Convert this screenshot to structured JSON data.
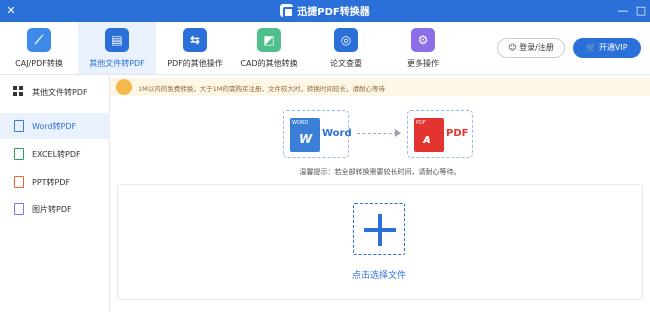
{
  "window": {
    "title": "迅捷PDF转换器",
    "close_glyph": "✕",
    "min_glyph": "—",
    "max_glyph": "□"
  },
  "toolbar": {
    "tools": [
      {
        "label": "CAJ/PDF转换",
        "icon": "caj-pdf-icon",
        "color": "#3d8be8",
        "glyph": "⟋",
        "active": false
      },
      {
        "label": "其他文件转PDF",
        "icon": "folder-icon",
        "color": "#2b6fd9",
        "glyph": "▤",
        "active": true
      },
      {
        "label": "PDF的其他操作",
        "icon": "swap-icon",
        "color": "#2b6fd9",
        "glyph": "⇆",
        "active": false
      },
      {
        "label": "CAD的其他转换",
        "icon": "cad-icon",
        "color": "#4fc08d",
        "glyph": "◩",
        "active": false
      },
      {
        "label": "论文查重",
        "icon": "search-check-icon",
        "color": "#2b6fd9",
        "glyph": "◎",
        "active": false
      },
      {
        "label": "更多操作",
        "icon": "gear-icon",
        "color": "#8c6ee8",
        "glyph": "⚙",
        "active": false
      }
    ],
    "login_label": "登录/注册",
    "vip_label": "开通VIP"
  },
  "sidebar": {
    "heading": "其他文件转PDF",
    "items": [
      {
        "label": "Word转PDF",
        "icon": "word-file-icon",
        "color": "#3b7ed8",
        "active": true
      },
      {
        "label": "EXCEL转PDF",
        "icon": "excel-file-icon",
        "color": "#2e9e5b",
        "active": false
      },
      {
        "label": "PPT转PDF",
        "icon": "ppt-file-icon",
        "color": "#e0672f",
        "active": false
      },
      {
        "label": "图片转PDF",
        "icon": "image-file-icon",
        "color": "#8c6ee8",
        "active": false
      }
    ]
  },
  "notice": {
    "text": "1M以内的免费转换，大于1M的需购买注册，文件较大时，转换时间较长，请耐心等待"
  },
  "conversion": {
    "from_tag": "WORD",
    "from_glyph": "W",
    "from_label": "Word",
    "to_tag": "PDF",
    "to_glyph": "ᴀ",
    "to_label": "PDF"
  },
  "tip": "温馨提示：若全部转换需要较长时间，请耐心等待。",
  "dropzone": {
    "choose_label": "点击选择文件"
  }
}
